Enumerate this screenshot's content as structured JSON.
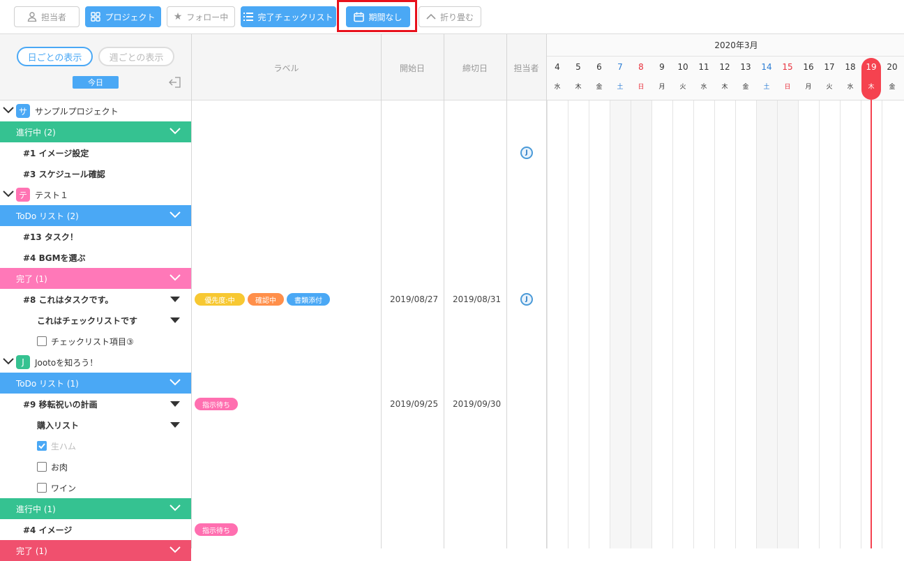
{
  "toolbar": {
    "assignee": "担当者",
    "project": "プロジェクト",
    "follow": "フォロー中",
    "checklist": "完了チェックリスト",
    "nodue": "期間なし",
    "collapse": "折り畳む"
  },
  "left_header": {
    "daily": "日ごとの表示",
    "weekly": "週ごとの表示",
    "today": "今日"
  },
  "columns": {
    "label": "ラベル",
    "start": "開始日",
    "due": "締切日",
    "assignee": "担当者"
  },
  "calendar": {
    "month": "2020年3月",
    "days": [
      {
        "n": "4",
        "w": "水",
        "type": "weekday"
      },
      {
        "n": "5",
        "w": "木",
        "type": "weekday"
      },
      {
        "n": "6",
        "w": "金",
        "type": "weekday"
      },
      {
        "n": "7",
        "w": "土",
        "type": "sat"
      },
      {
        "n": "8",
        "w": "日",
        "type": "sun"
      },
      {
        "n": "9",
        "w": "月",
        "type": "weekday"
      },
      {
        "n": "10",
        "w": "火",
        "type": "weekday"
      },
      {
        "n": "11",
        "w": "水",
        "type": "weekday"
      },
      {
        "n": "12",
        "w": "木",
        "type": "weekday"
      },
      {
        "n": "13",
        "w": "金",
        "type": "weekday"
      },
      {
        "n": "14",
        "w": "土",
        "type": "sat"
      },
      {
        "n": "15",
        "w": "日",
        "type": "sun"
      },
      {
        "n": "16",
        "w": "月",
        "type": "weekday"
      },
      {
        "n": "17",
        "w": "火",
        "type": "weekday"
      },
      {
        "n": "18",
        "w": "水",
        "type": "weekday"
      },
      {
        "n": "19",
        "w": "木",
        "type": "today"
      },
      {
        "n": "20",
        "w": "金",
        "type": "weekday"
      }
    ]
  },
  "rows": [
    {
      "kind": "project",
      "text": "サンプルプロジェクト",
      "icon": "サ",
      "color": "#4aa8f5"
    },
    {
      "kind": "group",
      "text": "進行中 (2)",
      "color": "#35c291"
    },
    {
      "kind": "task",
      "text": "#1 イメージ設定",
      "assignee": "J"
    },
    {
      "kind": "task",
      "text": "#3 スケジュール確認"
    },
    {
      "kind": "project",
      "text": "テスト１",
      "icon": "テ",
      "color": "#ff73b3"
    },
    {
      "kind": "group",
      "text": "ToDo リスト (2)",
      "color": "#4aa8f5"
    },
    {
      "kind": "task",
      "text": "#13 タスク！"
    },
    {
      "kind": "task",
      "text": "#4 BGMを選ぶ"
    },
    {
      "kind": "group",
      "text": "完了 (1)",
      "color": "#ff78b8"
    },
    {
      "kind": "task",
      "text": "#8 これはタスクです。",
      "tri": true,
      "tags": [
        {
          "t": "優先度:中",
          "c": "#f7c832"
        },
        {
          "t": "確認中",
          "c": "#ff8f4a"
        },
        {
          "t": "書類添付",
          "c": "#4aa8f5"
        }
      ],
      "start": "2019/08/27",
      "due": "2019/08/31",
      "assignee": "J"
    },
    {
      "kind": "checklist",
      "text": "これはチェックリストです",
      "tri": true
    },
    {
      "kind": "check",
      "text": "チェックリスト項目③",
      "checked": false
    },
    {
      "kind": "project",
      "text": "Jootoを知ろう！",
      "icon": "J",
      "color": "#35c291"
    },
    {
      "kind": "group",
      "text": "ToDo リスト (1)",
      "color": "#4aa8f5"
    },
    {
      "kind": "task",
      "text": "#9 移転祝いの計画",
      "tri": true,
      "tags": [
        {
          "t": "指示待ち",
          "c": "#ff6fb0"
        }
      ],
      "start": "2019/09/25",
      "due": "2019/09/30"
    },
    {
      "kind": "checklist",
      "text": "購入リスト",
      "tri": true
    },
    {
      "kind": "check",
      "text": "生ハム",
      "checked": true
    },
    {
      "kind": "check",
      "text": "お肉",
      "checked": false
    },
    {
      "kind": "check",
      "text": "ワイン",
      "checked": false
    },
    {
      "kind": "group",
      "text": "進行中 (1)",
      "color": "#35c291"
    },
    {
      "kind": "task",
      "text": "#4 イメージ",
      "tags": [
        {
          "t": "指示待ち",
          "c": "#ff6fb0"
        }
      ]
    },
    {
      "kind": "group",
      "text": "完了 (1)",
      "color": "#f0506e"
    }
  ],
  "colors": {
    "accent": "#4aa8f5",
    "highlight": "#e8111c",
    "today": "#f5424f"
  }
}
